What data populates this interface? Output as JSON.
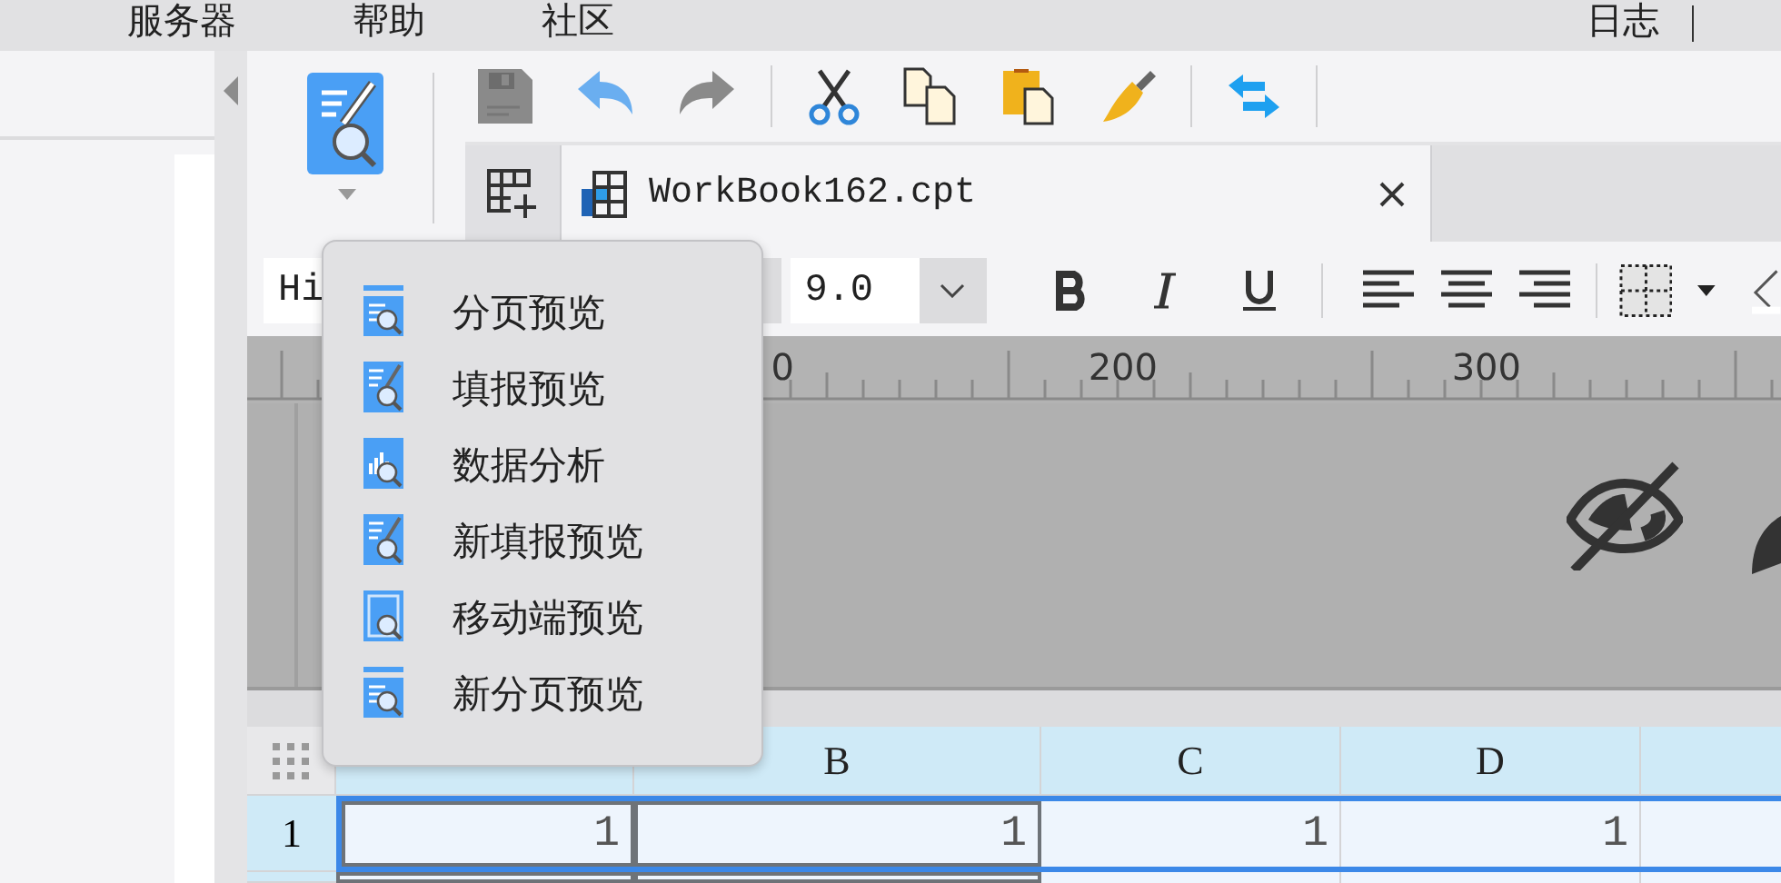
{
  "menu_bar": {
    "left": [
      "服务器",
      "帮助",
      "社区"
    ],
    "right": [
      "日志"
    ]
  },
  "toolbar": {
    "save": {
      "disabled": true
    },
    "undo": {
      "disabled": false
    },
    "redo": {
      "disabled": true
    }
  },
  "tabs": [
    {
      "label": "WorkBook162.cpt",
      "selected": true
    }
  ],
  "format_bar": {
    "font": "Hi",
    "size": "9.0"
  },
  "ruler": {
    "labels": [
      "0",
      "200",
      "300"
    ]
  },
  "preview_menu": {
    "items": [
      {
        "label": "分页预览",
        "kind": "page"
      },
      {
        "label": "填报预览",
        "kind": "fill"
      },
      {
        "label": "数据分析",
        "kind": "analysis"
      },
      {
        "label": "新填报预览",
        "kind": "fill"
      },
      {
        "label": "移动端预览",
        "kind": "mobile"
      },
      {
        "label": "新分页预览",
        "kind": "page"
      }
    ]
  },
  "sheet": {
    "columns": [
      "B",
      "C",
      "D"
    ],
    "rows": [
      {
        "header": "1",
        "cells": [
          "1",
          "1",
          "1",
          "1"
        ],
        "selected": true
      }
    ]
  }
}
